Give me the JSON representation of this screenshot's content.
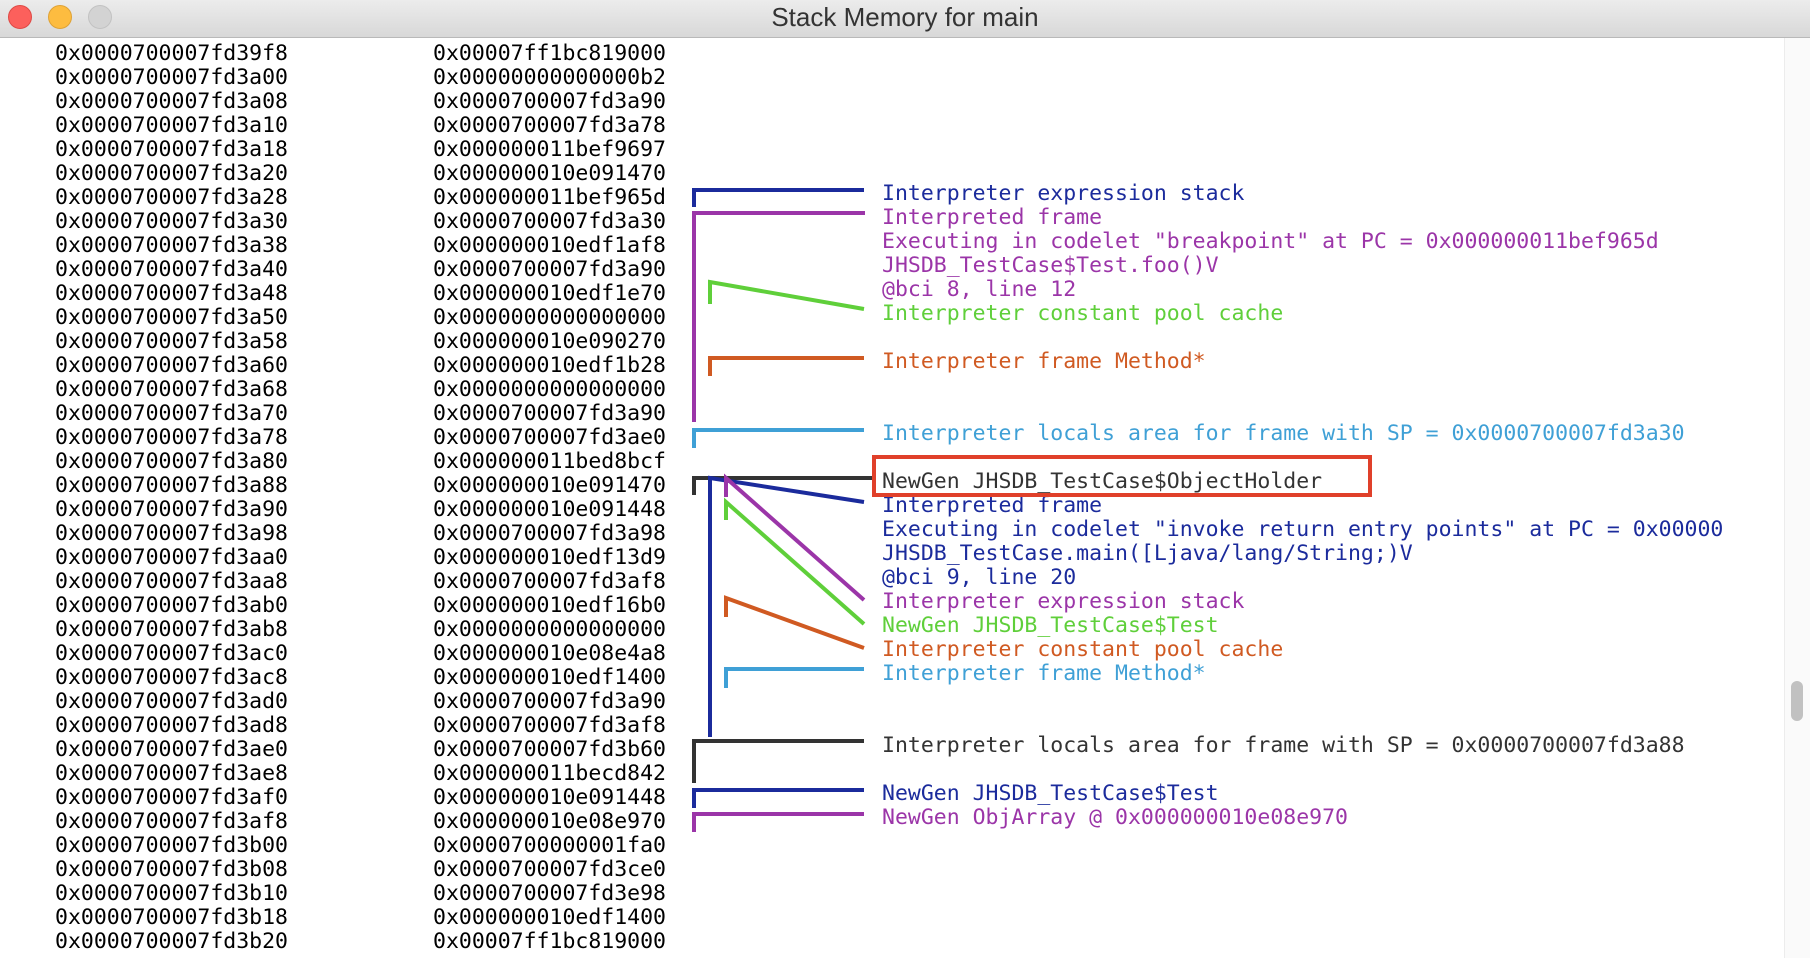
{
  "window": {
    "title": "Stack Memory for main"
  },
  "colors": {
    "navy": "#1b2b9c",
    "purple": "#9b35a8",
    "green": "#5fcf3a",
    "orange": "#d05a22",
    "cyan": "#3fa0d6",
    "dark": "#333333",
    "highlight": "#e0402a"
  },
  "rows": [
    {
      "addr": "0x0000700007fd39f8",
      "val": "0x00007ff1bc819000"
    },
    {
      "addr": "0x0000700007fd3a00",
      "val": "0x00000000000000b2"
    },
    {
      "addr": "0x0000700007fd3a08",
      "val": "0x0000700007fd3a90"
    },
    {
      "addr": "0x0000700007fd3a10",
      "val": "0x0000700007fd3a78"
    },
    {
      "addr": "0x0000700007fd3a18",
      "val": "0x000000011bef9697"
    },
    {
      "addr": "0x0000700007fd3a20",
      "val": "0x000000010e091470"
    },
    {
      "addr": "0x0000700007fd3a28",
      "val": "0x000000011bef965d"
    },
    {
      "addr": "0x0000700007fd3a30",
      "val": "0x0000700007fd3a30"
    },
    {
      "addr": "0x0000700007fd3a38",
      "val": "0x000000010edf1af8"
    },
    {
      "addr": "0x0000700007fd3a40",
      "val": "0x0000700007fd3a90"
    },
    {
      "addr": "0x0000700007fd3a48",
      "val": "0x000000010edf1e70"
    },
    {
      "addr": "0x0000700007fd3a50",
      "val": "0x0000000000000000"
    },
    {
      "addr": "0x0000700007fd3a58",
      "val": "0x000000010e090270"
    },
    {
      "addr": "0x0000700007fd3a60",
      "val": "0x000000010edf1b28"
    },
    {
      "addr": "0x0000700007fd3a68",
      "val": "0x0000000000000000"
    },
    {
      "addr": "0x0000700007fd3a70",
      "val": "0x0000700007fd3a90"
    },
    {
      "addr": "0x0000700007fd3a78",
      "val": "0x0000700007fd3ae0"
    },
    {
      "addr": "0x0000700007fd3a80",
      "val": "0x000000011bed8bcf"
    },
    {
      "addr": "0x0000700007fd3a88",
      "val": "0x000000010e091470"
    },
    {
      "addr": "0x0000700007fd3a90",
      "val": "0x000000010e091448"
    },
    {
      "addr": "0x0000700007fd3a98",
      "val": "0x0000700007fd3a98"
    },
    {
      "addr": "0x0000700007fd3aa0",
      "val": "0x000000010edf13d9"
    },
    {
      "addr": "0x0000700007fd3aa8",
      "val": "0x0000700007fd3af8"
    },
    {
      "addr": "0x0000700007fd3ab0",
      "val": "0x000000010edf16b0"
    },
    {
      "addr": "0x0000700007fd3ab8",
      "val": "0x0000000000000000"
    },
    {
      "addr": "0x0000700007fd3ac0",
      "val": "0x000000010e08e4a8"
    },
    {
      "addr": "0x0000700007fd3ac8",
      "val": "0x000000010edf1400"
    },
    {
      "addr": "0x0000700007fd3ad0",
      "val": "0x0000700007fd3a90"
    },
    {
      "addr": "0x0000700007fd3ad8",
      "val": "0x0000700007fd3af8"
    },
    {
      "addr": "0x0000700007fd3ae0",
      "val": "0x0000700007fd3b60"
    },
    {
      "addr": "0x0000700007fd3ae8",
      "val": "0x000000011becd842"
    },
    {
      "addr": "0x0000700007fd3af0",
      "val": "0x000000010e091448"
    },
    {
      "addr": "0x0000700007fd3af8",
      "val": "0x000000010e08e970"
    },
    {
      "addr": "0x0000700007fd3b00",
      "val": "0x0000700000001fa0"
    },
    {
      "addr": "0x0000700007fd3b08",
      "val": "0x0000700007fd3ce0"
    },
    {
      "addr": "0x0000700007fd3b10",
      "val": "0x0000700007fd3e98"
    },
    {
      "addr": "0x0000700007fd3b18",
      "val": "0x000000010edf1400"
    },
    {
      "addr": "0x0000700007fd3b20",
      "val": "0x00007ff1bc819000"
    }
  ],
  "annotations": [
    {
      "text": "Interpreter expression stack",
      "color": "#1b2b9c"
    },
    {
      "text": "Interpreted frame",
      "color": "#9b35a8"
    },
    {
      "text": "Executing in codelet \"breakpoint\" at PC = 0x000000011bef965d",
      "color": "#9b35a8"
    },
    {
      "text": "JHSDB_TestCase$Test.foo()V",
      "color": "#9b35a8"
    },
    {
      "text": "@bci 8, line 12",
      "color": "#9b35a8"
    },
    {
      "text": "Interpreter constant pool cache",
      "color": "#5fcf3a"
    },
    {
      "text": "Interpreter frame Method*",
      "color": "#d05a22"
    },
    {
      "text": "Interpreter locals area for frame with SP = 0x0000700007fd3a30",
      "color": "#3fa0d6"
    },
    {
      "text": "NewGen JHSDB_TestCase$ObjectHolder",
      "color": "#333333"
    },
    {
      "text": "Interpreted frame",
      "color": "#1b2b9c"
    },
    {
      "text": "Executing in codelet \"invoke return entry points\" at PC = 0x00000",
      "color": "#1b2b9c"
    },
    {
      "text": "JHSDB_TestCase.main([Ljava/lang/String;)V",
      "color": "#1b2b9c"
    },
    {
      "text": "@bci 9, line 20",
      "color": "#1b2b9c"
    },
    {
      "text": "Interpreter expression stack",
      "color": "#9b35a8"
    },
    {
      "text": "NewGen JHSDB_TestCase$Test",
      "color": "#5fcf3a"
    },
    {
      "text": "Interpreter constant pool cache",
      "color": "#d05a22"
    },
    {
      "text": "Interpreter frame Method*",
      "color": "#3fa0d6"
    },
    {
      "text": "Interpreter locals area for frame with SP = 0x0000700007fd3a88",
      "color": "#333333"
    },
    {
      "text": "NewGen JHSDB_TestCase$Test",
      "color": "#1b2b9c"
    },
    {
      "text": "NewGen ObjArray @ 0x000000010e08e970",
      "color": "#9b35a8"
    }
  ]
}
